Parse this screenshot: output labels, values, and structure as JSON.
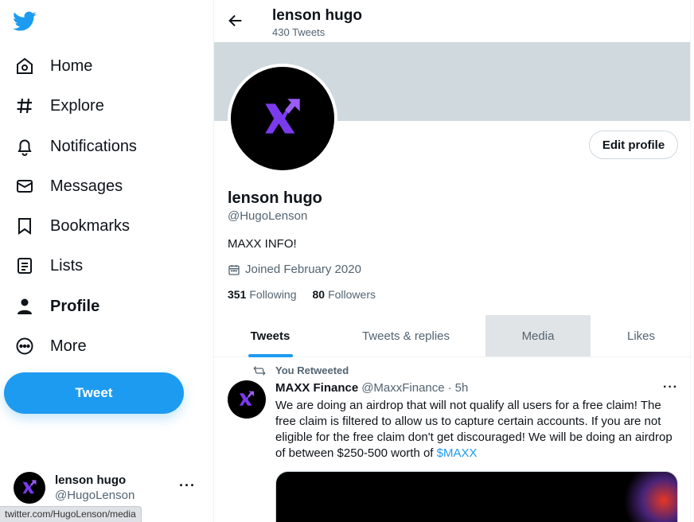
{
  "sidebar": {
    "nav": [
      {
        "label": "Home",
        "icon": "home-icon"
      },
      {
        "label": "Explore",
        "icon": "hashtag-icon"
      },
      {
        "label": "Notifications",
        "icon": "bell-icon"
      },
      {
        "label": "Messages",
        "icon": "envelope-icon"
      },
      {
        "label": "Bookmarks",
        "icon": "bookmark-icon"
      },
      {
        "label": "Lists",
        "icon": "list-icon"
      },
      {
        "label": "Profile",
        "icon": "person-icon",
        "active": true
      },
      {
        "label": "More",
        "icon": "more-circle-icon"
      }
    ],
    "tweet_button": "Tweet",
    "account": {
      "name": "lenson hugo",
      "handle": "@HugoLenson",
      "more": "···"
    }
  },
  "status_bar": {
    "url": "twitter.com/HugoLenson/media"
  },
  "header": {
    "name": "lenson hugo",
    "tweet_count": "430 Tweets"
  },
  "profile": {
    "name": "lenson hugo",
    "handle": "@HugoLenson",
    "bio": "MAXX INFO!",
    "joined": "Joined February 2020",
    "following_count": "351",
    "following_label": "Following",
    "followers_count": "80",
    "followers_label": "Followers",
    "edit_button": "Edit profile"
  },
  "tabs": [
    {
      "label": "Tweets",
      "active": true
    },
    {
      "label": "Tweets & replies"
    },
    {
      "label": "Media",
      "hovered": true
    },
    {
      "label": "Likes"
    }
  ],
  "tweet": {
    "retweet_label": "You Retweeted",
    "author_name": "MAXX Finance",
    "author_handle": "@MaxxFinance",
    "separator": "·",
    "time": "5h",
    "more": "···",
    "text": "We are doing an airdrop that will not qualify all users for a free claim! The free claim is filtered to allow us to capture certain accounts. If you are not eligible for the free claim don't get discouraged! We will be doing an airdrop of between $250-500 worth of ",
    "cashtag": "$MAXX"
  },
  "colors": {
    "accent": "#1d9bf0",
    "banner": "#cfd9de",
    "logo_purple": "#7c3aed",
    "text_secondary": "#536471"
  }
}
